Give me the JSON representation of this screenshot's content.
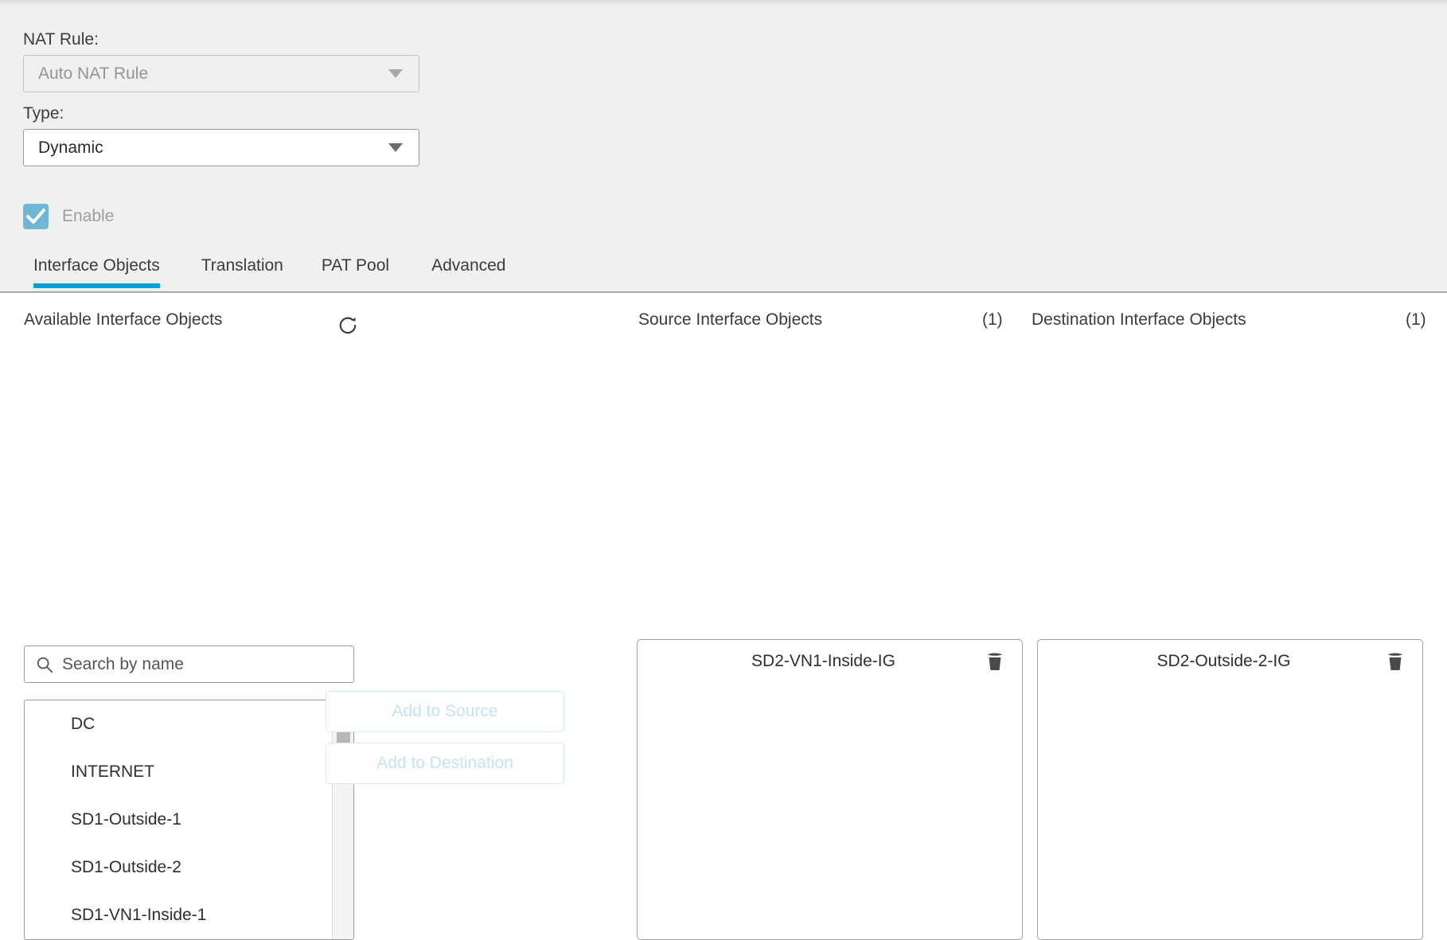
{
  "form": {
    "nat_rule": {
      "label": "NAT Rule:",
      "value": "Auto NAT Rule",
      "caret_icon": "chevron-down-icon",
      "disabled": true
    },
    "type": {
      "label": "Type:",
      "value": "Dynamic",
      "caret_icon": "chevron-down-icon",
      "disabled": false
    },
    "enable": {
      "label": "Enable",
      "checked": true,
      "disabled": true
    }
  },
  "tabs": [
    {
      "label": "Interface Objects",
      "active": true
    },
    {
      "label": "Translation",
      "active": false
    },
    {
      "label": "PAT Pool",
      "active": false
    },
    {
      "label": "Advanced",
      "active": false
    }
  ],
  "available": {
    "title": "Available Interface Objects",
    "refresh_icon": "refresh-icon",
    "search": {
      "placeholder": "Search by name",
      "value": "",
      "icon": "search-icon"
    },
    "items": [
      "DC",
      "INTERNET",
      "SD1-Outside-1",
      "SD1-Outside-2",
      "SD1-VN1-Inside-1"
    ]
  },
  "actions": {
    "add_to_source": "Add to Source",
    "add_to_destination": "Add to Destination"
  },
  "source": {
    "title": "Source Interface Objects",
    "count": "(1)",
    "items": [
      {
        "label": "SD2-VN1-Inside-IG",
        "delete_icon": "trash-icon"
      }
    ]
  },
  "destination": {
    "title": "Destination Interface Objects",
    "count": "(1)",
    "items": [
      {
        "label": "SD2-Outside-2-IG",
        "delete_icon": "trash-icon"
      }
    ]
  },
  "colors": {
    "accent": "#089fd7",
    "checkbox": "#6fb7d6",
    "form_bg": "#f0f0f0",
    "disabled_button_text": "#c4e3f2"
  }
}
